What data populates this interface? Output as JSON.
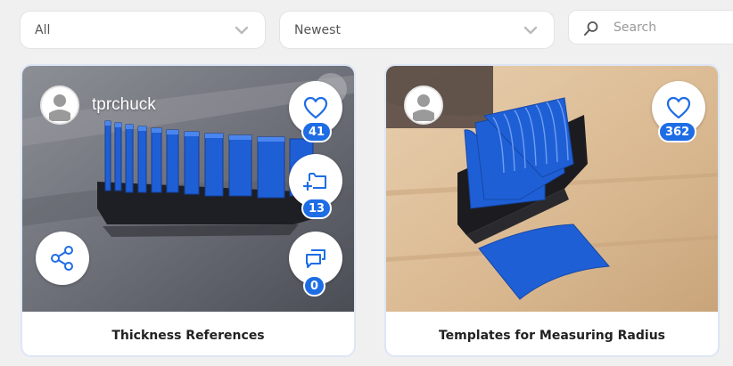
{
  "filters": {
    "category": {
      "selected": "All"
    },
    "sort": {
      "selected": "Newest"
    },
    "search": {
      "placeholder": "Search"
    }
  },
  "cards": [
    {
      "title": "Thickness References",
      "author": "tprchuck",
      "likes": "41",
      "collections": "13",
      "comments": "0"
    },
    {
      "title": "Templates for Measuring Radius",
      "likes": "362"
    }
  ],
  "colors": {
    "accent": "#1e6de5",
    "page_background": "#f0f0f0",
    "print_blue": "#1f5fd6",
    "card_border": "#dde6f6"
  },
  "icons": [
    "chevron-down-icon",
    "search-icon",
    "heart-icon",
    "add-to-collection-icon",
    "comments-icon",
    "share-icon",
    "user-avatar-icon"
  ]
}
